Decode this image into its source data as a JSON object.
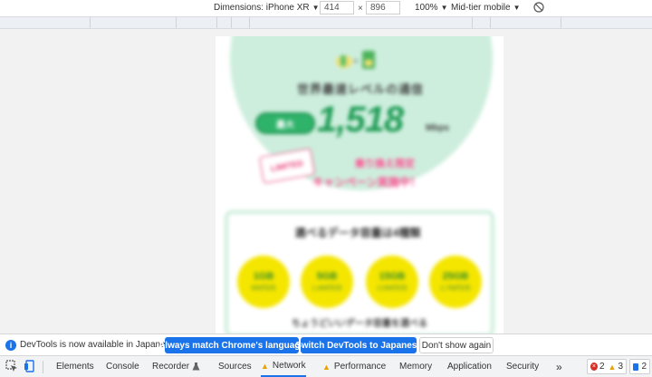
{
  "device_toolbar": {
    "dimensions_label": "Dimensions: iPhone XR",
    "width": "414",
    "height": "896",
    "x_sep": "×",
    "zoom": "100%",
    "throttling": "Mid-tier mobile",
    "caret": "▼"
  },
  "page": {
    "hero_title": "世界最速レベルの通信",
    "hero_pill": "最大",
    "hero_number": "1,518",
    "hero_unit": "Mbps",
    "hero_tag": "LIMITED",
    "hero_pink_line1": "乗り換え限定",
    "hero_pink_line2": "キャンペーン実施中！",
    "panel_title": "選べるデータ容量は4種類",
    "coins": [
      {
        "top": "1GB",
        "bottom": "990円/月"
      },
      {
        "top": "5GB",
        "bottom": "1,490円/月"
      },
      {
        "top": "15GB",
        "bottom": "2,090円/月"
      },
      {
        "top": "25GB",
        "bottom": "2,790円/月"
      }
    ],
    "panel_footer": "ちょうどいいデータ容量を選べる"
  },
  "notification": {
    "info_icon": "i",
    "text": "DevTools is now available in Japanese!",
    "btn_match": "Always match Chrome's language",
    "btn_switch": "Switch DevTools to Japanese",
    "btn_dismiss": "Don't show again"
  },
  "tabs": {
    "elements": "Elements",
    "console": "Console",
    "recorder": "Recorder",
    "sources": "Sources",
    "network": "Network",
    "performance": "Performance",
    "memory": "Memory",
    "application": "Application",
    "security": "Security",
    "more": "»",
    "errors": "2",
    "warnings": "3",
    "messages": "2"
  },
  "colors": {
    "accent": "#1a73e8",
    "hero_green": "#cdeedd",
    "brand_green": "#1f9c55",
    "pink": "#ff4f93",
    "coin_yellow": "#f5e600",
    "warning": "#e8a300",
    "error": "#d93025"
  }
}
